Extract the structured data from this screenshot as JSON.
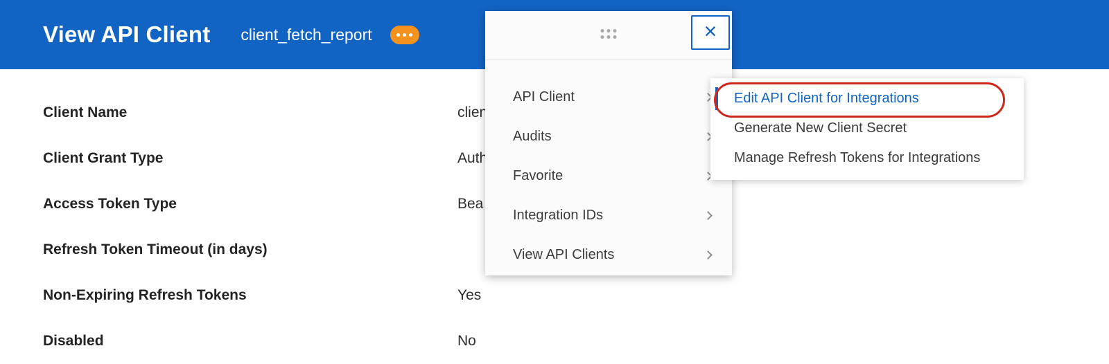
{
  "header": {
    "title": "View API Client",
    "subtitle": "client_fetch_report"
  },
  "icons": {
    "close": "×",
    "related_actions": "ellipsis-icon",
    "drag_handle": "grid-dots-icon",
    "menu_chevron": "chevron-right-icon"
  },
  "detail_rows": [
    {
      "label": "Client Name",
      "value": "client_fetch_report"
    },
    {
      "label": "Client Grant Type",
      "value": "Auth"
    },
    {
      "label": "Access Token Type",
      "value": "Bea"
    },
    {
      "label": "Refresh Token Timeout (in days)",
      "value": ""
    },
    {
      "label": "Non-Expiring Refresh Tokens",
      "value": "Yes"
    },
    {
      "label": "Disabled",
      "value": "No"
    }
  ],
  "menu": {
    "items": [
      {
        "label": "API Client"
      },
      {
        "label": "Audits"
      },
      {
        "label": "Favorite"
      },
      {
        "label": "Integration IDs"
      },
      {
        "label": "View API Clients"
      }
    ]
  },
  "submenu": {
    "items": [
      {
        "label": "Edit API Client for Integrations",
        "highlighted": true
      },
      {
        "label": "Generate New Client Secret",
        "highlighted": false
      },
      {
        "label": "Manage Refresh Tokens for Integrations",
        "highlighted": false
      }
    ]
  },
  "annotation": {
    "shape": "red-oval",
    "target": "Edit API Client for Integrations",
    "color": "#d0271d"
  },
  "colors": {
    "header_blue": "#1164c4",
    "accent_orange": "#f5921e",
    "link_blue": "#1164c4",
    "annotation_red": "#d0271d"
  }
}
